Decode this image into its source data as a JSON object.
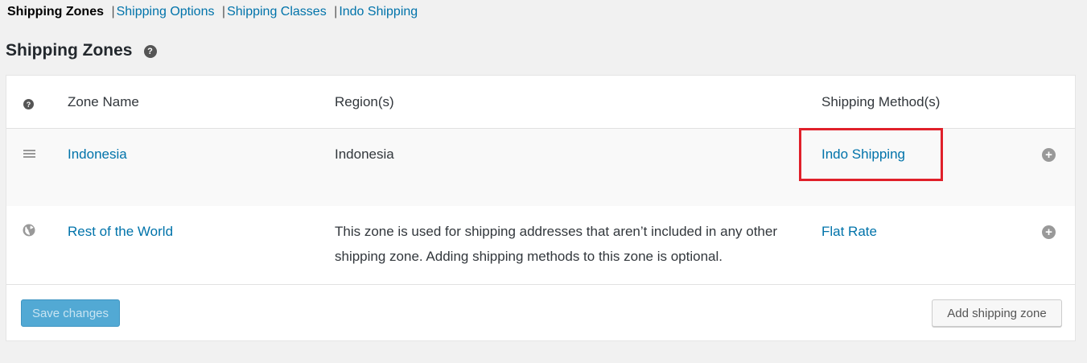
{
  "subnav": {
    "items": [
      {
        "label": "Shipping Zones",
        "current": true
      },
      {
        "label": "Shipping Options",
        "current": false
      },
      {
        "label": "Shipping Classes",
        "current": false
      },
      {
        "label": "Indo Shipping",
        "current": false
      }
    ],
    "separator": "|"
  },
  "page": {
    "title": "Shipping Zones",
    "help_icon": "question-circle-icon"
  },
  "table": {
    "headers": {
      "zone_name": "Zone Name",
      "regions": "Region(s)",
      "methods": "Shipping Method(s)"
    },
    "rows": [
      {
        "zone_name": "Indonesia",
        "region": "Indonesia",
        "method": "Indo Shipping",
        "icon": "drag-handle-icon"
      },
      {
        "zone_name": "Rest of the World",
        "region": "This zone is used for shipping addresses that aren’t included in any other shipping zone. Adding shipping methods to this zone is optional.",
        "method": "Flat Rate",
        "icon": "globe-icon"
      }
    ]
  },
  "actions": {
    "save_label": "Save changes",
    "add_zone_label": "Add shipping zone"
  },
  "colors": {
    "link": "#0073aa",
    "highlight": "#e0202a",
    "primary_button": "#52a9d4"
  }
}
